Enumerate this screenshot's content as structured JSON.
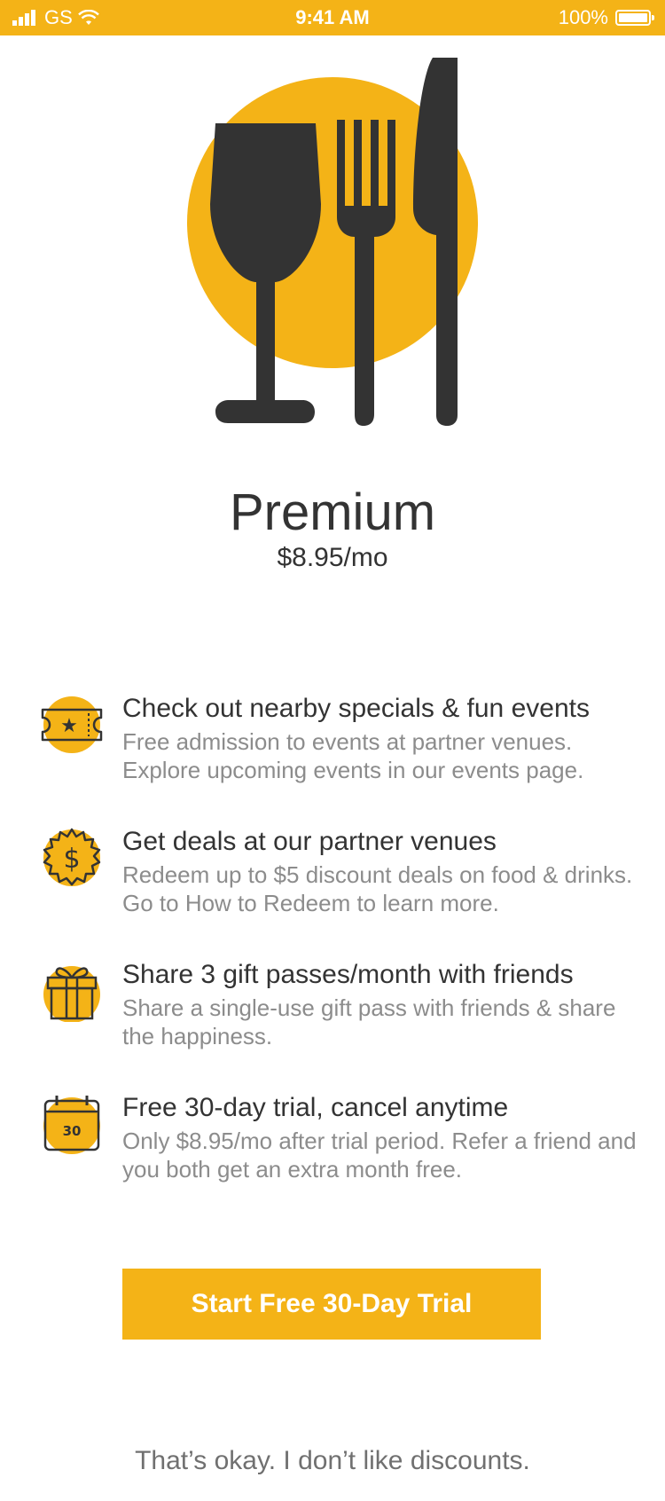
{
  "status_bar": {
    "carrier": "GS",
    "time": "9:41 AM",
    "battery": "100%",
    "color": "#F4B317"
  },
  "hero": {
    "icon": "wine-glass-fork-knife-icon",
    "accent_color": "#F4B317",
    "icon_color": "#333333"
  },
  "plan": {
    "name": "Premium",
    "price": "$8.95/mo"
  },
  "features": [
    {
      "icon": "ticket-star-icon",
      "title": "Check out nearby specials & fun events",
      "description": "Free admission to events at partner venues. Explore upcoming events in our events page."
    },
    {
      "icon": "dollar-badge-icon",
      "title": "Get deals at our partner venues",
      "description": "Redeem up to $5 discount deals on food & drinks. Go to How to Redeem to learn more."
    },
    {
      "icon": "gift-icon",
      "title": "Share 3 gift passes/month with friends",
      "description": "Share a single-use gift pass with friends & share the happiness."
    },
    {
      "icon": "calendar-icon",
      "calendar_number": "30",
      "title": "Free 30-day trial, cancel anytime",
      "description": "Only $8.95/mo after trial period. Refer a friend and you both get an extra month free."
    }
  ],
  "cta": {
    "label": "Start Free 30-Day Trial"
  },
  "decline": {
    "label": "That’s okay. I don’t like discounts."
  }
}
